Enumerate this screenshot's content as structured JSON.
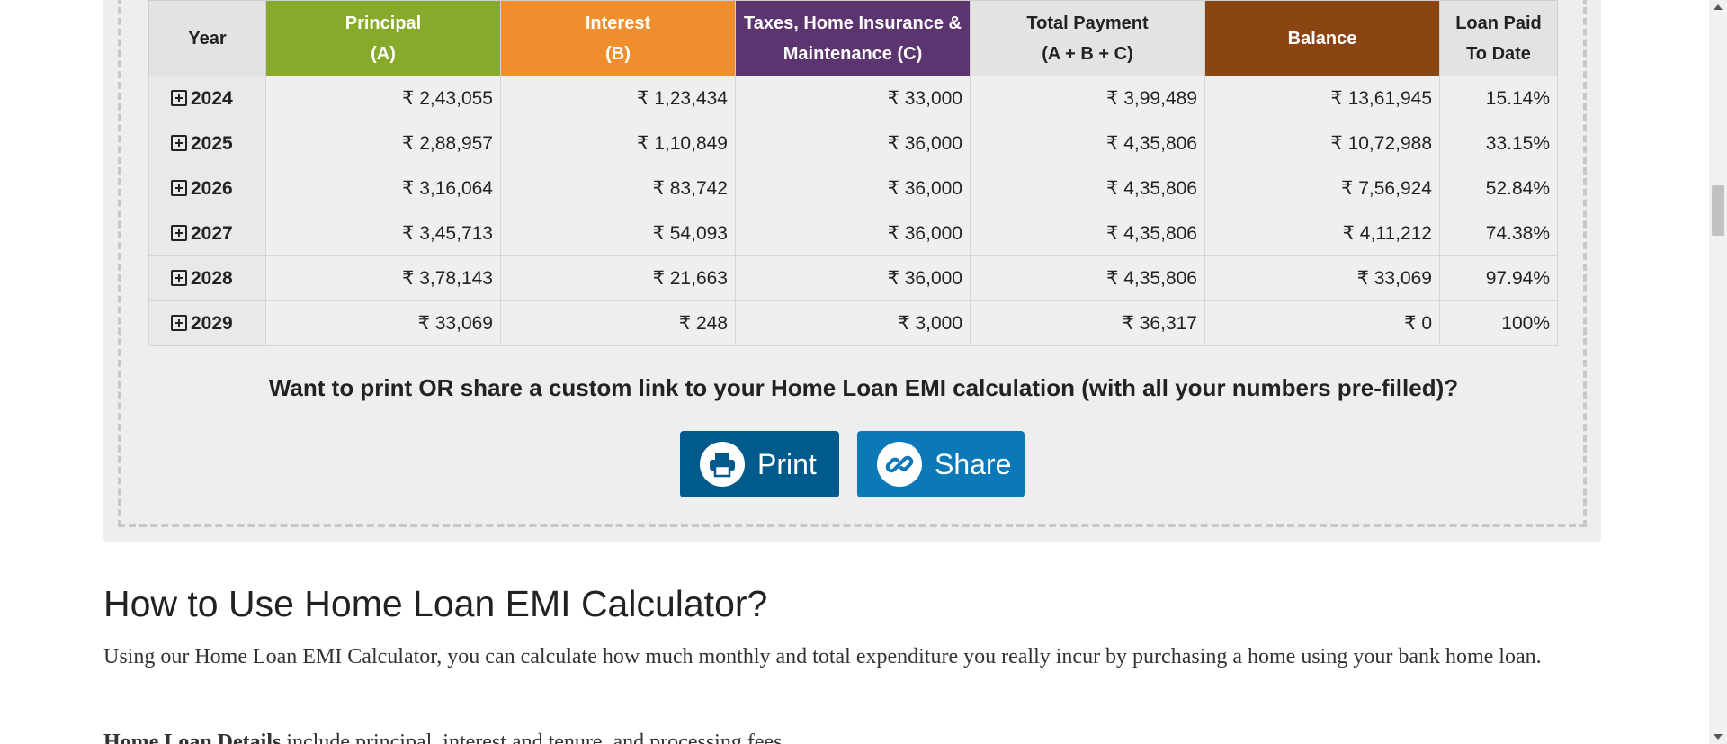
{
  "table": {
    "headers": {
      "year": {
        "l1": "Year",
        "l2": ""
      },
      "principal": {
        "l1": "Principal",
        "l2": "(A)"
      },
      "interest": {
        "l1": "Interest",
        "l2": "(B)"
      },
      "taxes": {
        "l1": "Taxes, Home Insurance &",
        "l2": "Maintenance (C)"
      },
      "total": {
        "l1": "Total Payment",
        "l2": "(A + B + C)"
      },
      "balance": {
        "l1": "Balance",
        "l2": ""
      },
      "paid": {
        "l1": "Loan Paid",
        "l2": "To Date"
      }
    },
    "rows": [
      {
        "year": "2024",
        "principal": "₹ 2,43,055",
        "interest": "₹ 1,23,434",
        "taxes": "₹ 33,000",
        "total": "₹ 3,99,489",
        "balance": "₹ 13,61,945",
        "paid": "15.14%"
      },
      {
        "year": "2025",
        "principal": "₹ 2,88,957",
        "interest": "₹ 1,10,849",
        "taxes": "₹ 36,000",
        "total": "₹ 4,35,806",
        "balance": "₹ 10,72,988",
        "paid": "33.15%"
      },
      {
        "year": "2026",
        "principal": "₹ 3,16,064",
        "interest": "₹ 83,742",
        "taxes": "₹ 36,000",
        "total": "₹ 4,35,806",
        "balance": "₹ 7,56,924",
        "paid": "52.84%"
      },
      {
        "year": "2027",
        "principal": "₹ 3,45,713",
        "interest": "₹ 54,093",
        "taxes": "₹ 36,000",
        "total": "₹ 4,35,806",
        "balance": "₹ 4,11,212",
        "paid": "74.38%"
      },
      {
        "year": "2028",
        "principal": "₹ 3,78,143",
        "interest": "₹ 21,663",
        "taxes": "₹ 36,000",
        "total": "₹ 4,35,806",
        "balance": "₹ 33,069",
        "paid": "97.94%"
      },
      {
        "year": "2029",
        "principal": "₹ 33,069",
        "interest": "₹ 248",
        "taxes": "₹ 3,000",
        "total": "₹ 36,317",
        "balance": "₹ 0",
        "paid": "100%"
      }
    ]
  },
  "share_prompt": "Want to print OR share a custom link to your Home Loan EMI calculation (with all your numbers pre-filled)?",
  "buttons": {
    "print": {
      "label": "Print",
      "icon": "printer-icon"
    },
    "share": {
      "label": "Share",
      "icon": "link-icon"
    }
  },
  "article": {
    "heading": "How to Use Home Loan EMI Calculator?",
    "intro": "Using our Home Loan EMI Calculator, you can calculate how much monthly and total expenditure you really incur by purchasing a home using your bank home loan.",
    "cutoff_bold": "Home Loan Details",
    "cutoff_rest": " include principal, interest and tenure, and processing fees."
  },
  "colors": {
    "principal": "#88aa2b",
    "interest": "#ee8e2d",
    "taxes": "#5c3470",
    "balance": "#8b4513",
    "print_button": "#005a8c",
    "share_button": "#0b79b8"
  }
}
